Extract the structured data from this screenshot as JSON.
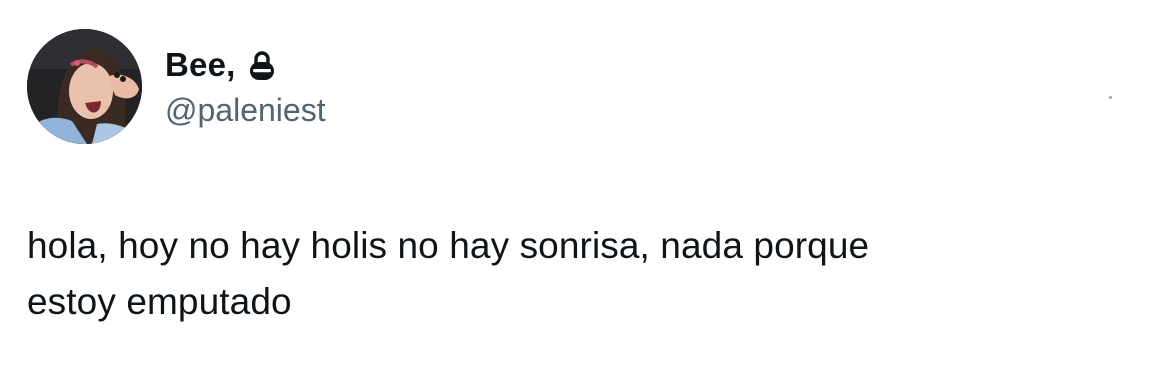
{
  "author": {
    "display_name": "Bee,",
    "handle": "@paleniest",
    "protected": true,
    "avatar_icon": "profile-photo",
    "lock_icon": "lock-icon"
  },
  "tweet": {
    "text": "hola, hoy no hay holis no hay sonrisa, nada porque\nestoy emputado"
  },
  "colors": {
    "text_primary": "#0f1419",
    "text_secondary": "#536471",
    "background": "#ffffff"
  }
}
